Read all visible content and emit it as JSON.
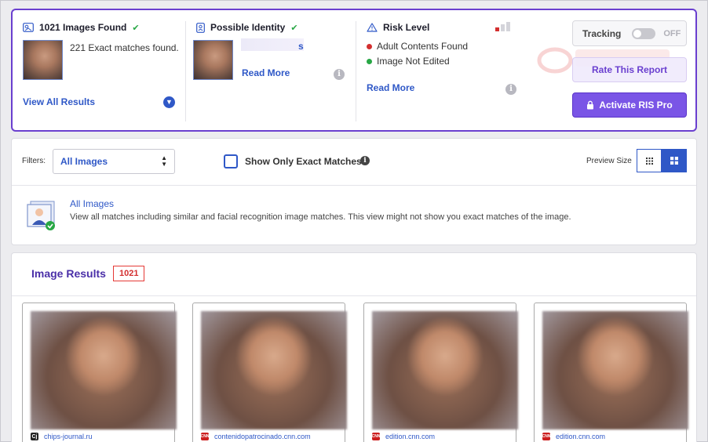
{
  "summary": {
    "found": {
      "title": "1021 Images Found",
      "exact_text": "221 Exact matches found.",
      "view_all": "View All Results"
    },
    "identity": {
      "title": "Possible Identity",
      "name_tail": "s",
      "read_more": "Read More"
    },
    "risk": {
      "title": "Risk Level",
      "items": [
        {
          "label": "Adult Contents Found",
          "color": "#d32f2f"
        },
        {
          "label": "Image Not Edited",
          "color": "#28a745"
        }
      ],
      "read_more": "Read More"
    },
    "tracking": {
      "label": "Tracking",
      "state": "OFF"
    },
    "rate_button": "Rate This Report",
    "pro_button": "Activate RIS Pro"
  },
  "filters": {
    "label": "Filters:",
    "selected": "All Images",
    "exact_only": "Show Only Exact Matches",
    "preview_label": "Preview Size",
    "view": {
      "title": "All Images",
      "description": "View all matches including similar and facial recognition image matches. This view might not show you exact matches of the image."
    }
  },
  "results": {
    "title": "Image Results",
    "count": "1021",
    "items": [
      {
        "source": "chips-journal.ru",
        "icon": "cj-icon"
      },
      {
        "source": "contenidopatrocinado.cnn.com",
        "icon": "cnn-icon"
      },
      {
        "source": "edition.cnn.com",
        "icon": "cnn-icon"
      },
      {
        "source": "edition.cnn.com",
        "icon": "cnn-icon"
      }
    ]
  },
  "colors": {
    "accent": "#6a3fcf",
    "link": "#2f58c7",
    "danger": "#d32f2f",
    "success": "#28a745"
  }
}
